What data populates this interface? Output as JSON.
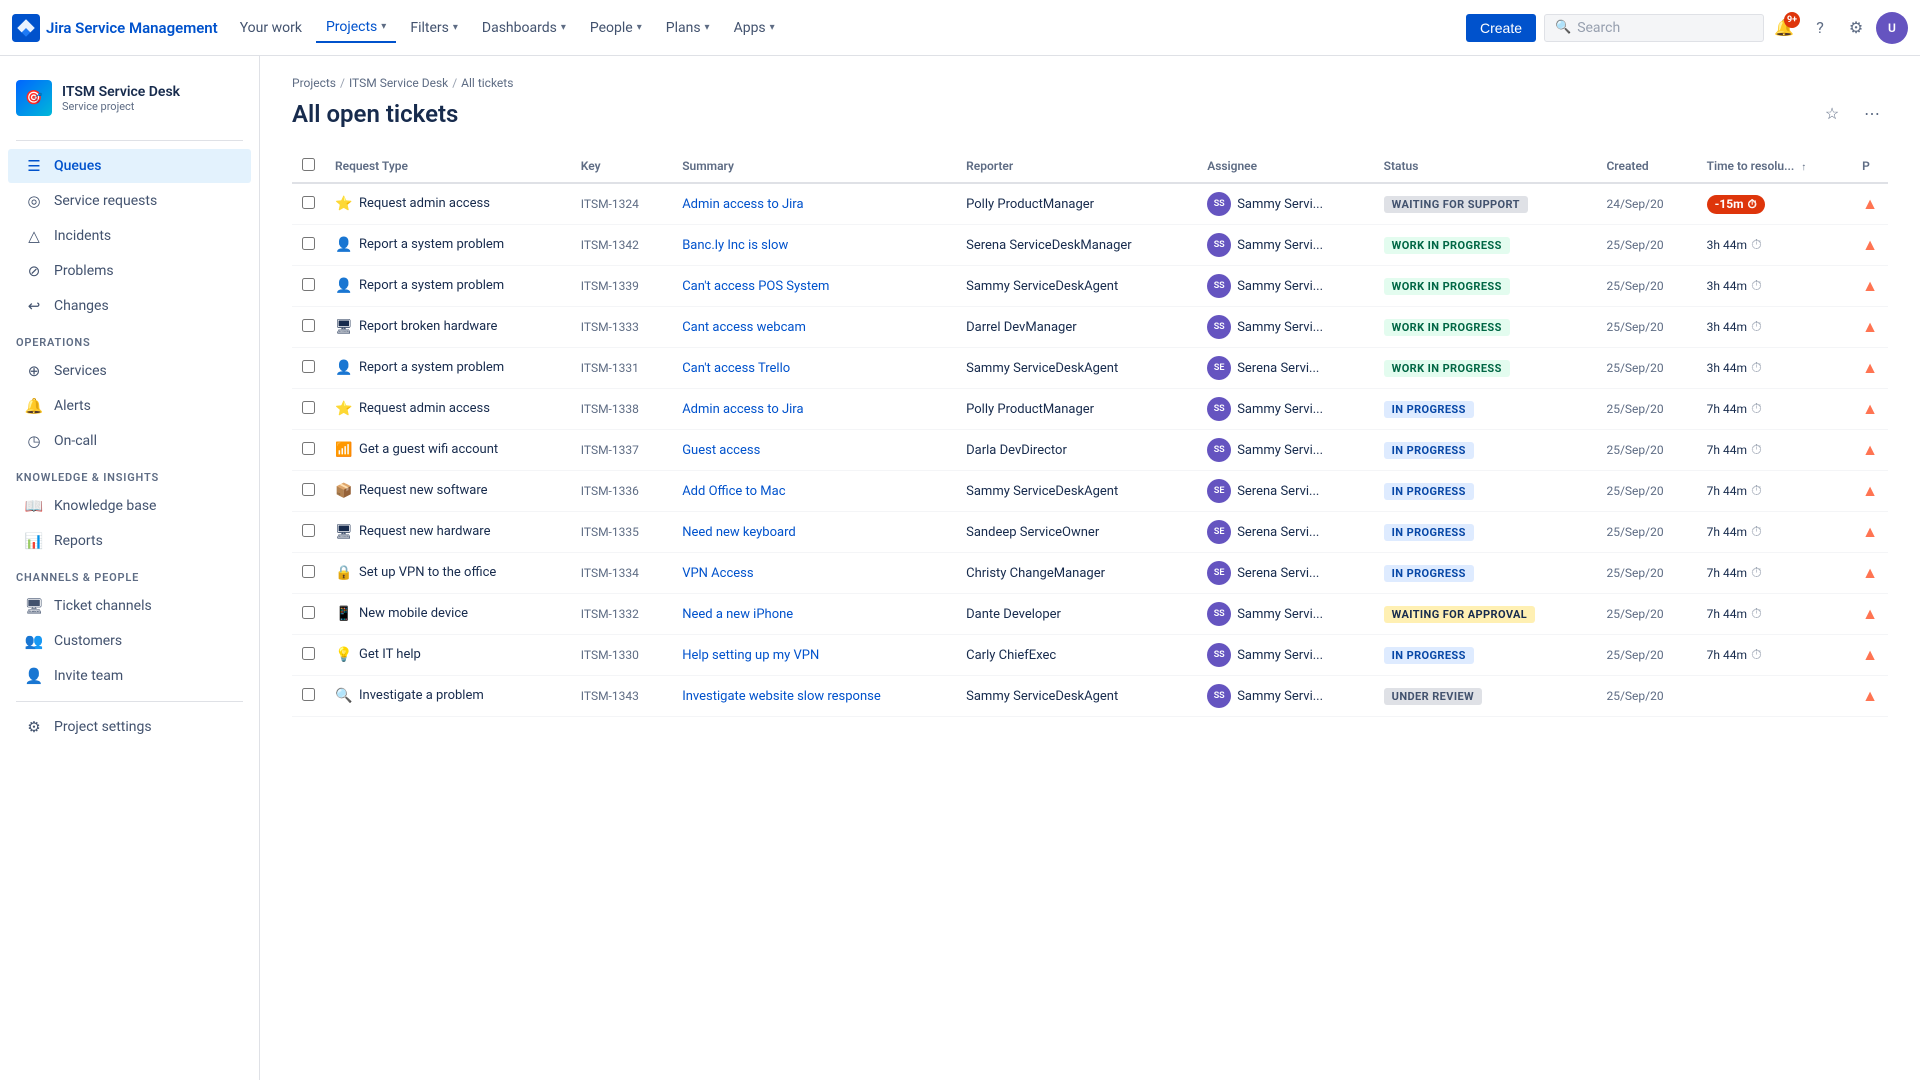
{
  "app": {
    "name": "Jira Service Management",
    "logo_text": "Jira Service Management"
  },
  "topnav": {
    "items": [
      {
        "id": "your-work",
        "label": "Your work",
        "active": false,
        "has_chevron": false
      },
      {
        "id": "projects",
        "label": "Projects",
        "active": true,
        "has_chevron": true
      },
      {
        "id": "filters",
        "label": "Filters",
        "active": false,
        "has_chevron": true
      },
      {
        "id": "dashboards",
        "label": "Dashboards",
        "active": false,
        "has_chevron": true
      },
      {
        "id": "people",
        "label": "People",
        "active": false,
        "has_chevron": true
      },
      {
        "id": "plans",
        "label": "Plans",
        "active": false,
        "has_chevron": true
      },
      {
        "id": "apps",
        "label": "Apps",
        "active": false,
        "has_chevron": true
      }
    ],
    "create_label": "Create",
    "search_placeholder": "Search",
    "notification_count": "9+",
    "avatar_initials": "U"
  },
  "sidebar": {
    "project_name": "ITSM Service Desk",
    "project_type": "Service project",
    "nav_items": [
      {
        "id": "queues",
        "label": "Queues",
        "icon": "☰",
        "active": true
      },
      {
        "id": "service-requests",
        "label": "Service requests",
        "icon": "◎",
        "active": false
      },
      {
        "id": "incidents",
        "label": "Incidents",
        "icon": "△",
        "active": false
      },
      {
        "id": "problems",
        "label": "Problems",
        "icon": "⊘",
        "active": false
      },
      {
        "id": "changes",
        "label": "Changes",
        "icon": "↩",
        "active": false
      }
    ],
    "operations_label": "OPERATIONS",
    "operations_items": [
      {
        "id": "services",
        "label": "Services",
        "icon": "⊕"
      },
      {
        "id": "alerts",
        "label": "Alerts",
        "icon": "🔔"
      },
      {
        "id": "on-call",
        "label": "On-call",
        "icon": "◷"
      }
    ],
    "knowledge_label": "KNOWLEDGE & INSIGHTS",
    "knowledge_items": [
      {
        "id": "knowledge-base",
        "label": "Knowledge base",
        "icon": "📖"
      },
      {
        "id": "reports",
        "label": "Reports",
        "icon": "📊"
      }
    ],
    "channels_label": "CHANNELS & PEOPLE",
    "channels_items": [
      {
        "id": "ticket-channels",
        "label": "Ticket channels",
        "icon": "🖥"
      },
      {
        "id": "customers",
        "label": "Customers",
        "icon": "👥"
      },
      {
        "id": "invite-team",
        "label": "Invite team",
        "icon": "👤"
      }
    ],
    "settings_label": "Project settings",
    "settings_icon": "⚙"
  },
  "breadcrumb": [
    {
      "label": "Projects",
      "href": "#"
    },
    {
      "label": "ITSM Service Desk",
      "href": "#"
    },
    {
      "label": "All tickets",
      "href": "#"
    }
  ],
  "page_title": "All open tickets",
  "table": {
    "columns": [
      {
        "id": "checkbox",
        "label": "",
        "type": "checkbox"
      },
      {
        "id": "request-type",
        "label": "Request Type"
      },
      {
        "id": "key",
        "label": "Key"
      },
      {
        "id": "summary",
        "label": "Summary"
      },
      {
        "id": "reporter",
        "label": "Reporter"
      },
      {
        "id": "assignee",
        "label": "Assignee"
      },
      {
        "id": "status",
        "label": "Status"
      },
      {
        "id": "created",
        "label": "Created"
      },
      {
        "id": "time-to-resolution",
        "label": "Time to resolu...",
        "sortable": true,
        "sort_icon": "↑"
      },
      {
        "id": "priority",
        "label": "P"
      }
    ],
    "rows": [
      {
        "checkbox": false,
        "request_type_icon": "⭐",
        "request_type": "Request admin access",
        "key": "ITSM-1324",
        "summary": "Admin access to Jira",
        "reporter": "Polly ProductManager",
        "assignee_initials": "SS",
        "assignee_name": "Sammy Servi...",
        "status": "WAITING FOR SUPPORT",
        "status_class": "status-waiting",
        "created": "24/Sep/20",
        "time": "-15m",
        "time_type": "overdue",
        "priority_icon": "▲",
        "priority_class": "priority-high"
      },
      {
        "checkbox": false,
        "request_type_icon": "👤",
        "request_type": "Report a system problem",
        "key": "ITSM-1342",
        "summary": "Banc.ly Inc is slow",
        "reporter": "Serena ServiceDeskManager",
        "assignee_initials": "SS",
        "assignee_name": "Sammy Servi...",
        "status": "WORK IN PROGRESS",
        "status_class": "status-work-in-progress",
        "created": "25/Sep/20",
        "time": "3h 44m",
        "time_type": "normal",
        "priority_icon": "▲",
        "priority_class": "priority-high"
      },
      {
        "checkbox": false,
        "request_type_icon": "👤",
        "request_type": "Report a system problem",
        "key": "ITSM-1339",
        "summary": "Can't access POS System",
        "reporter": "Sammy ServiceDeskAgent",
        "assignee_initials": "SS",
        "assignee_name": "Sammy Servi...",
        "status": "WORK IN PROGRESS",
        "status_class": "status-work-in-progress",
        "created": "25/Sep/20",
        "time": "3h 44m",
        "time_type": "normal",
        "priority_icon": "▲",
        "priority_class": "priority-high"
      },
      {
        "checkbox": false,
        "request_type_icon": "🖥",
        "request_type": "Report broken hardware",
        "key": "ITSM-1333",
        "summary": "Cant access webcam",
        "reporter": "Darrel DevManager",
        "assignee_initials": "SS",
        "assignee_name": "Sammy Servi...",
        "status": "WORK IN PROGRESS",
        "status_class": "status-work-in-progress",
        "created": "25/Sep/20",
        "time": "3h 44m",
        "time_type": "normal",
        "priority_icon": "▲",
        "priority_class": "priority-high"
      },
      {
        "checkbox": false,
        "request_type_icon": "👤",
        "request_type": "Report a system problem",
        "key": "ITSM-1331",
        "summary": "Can't access Trello",
        "reporter": "Sammy ServiceDeskAgent",
        "assignee_initials": "SE",
        "assignee_name": "Serena Servi...",
        "status": "WORK IN PROGRESS",
        "status_class": "status-work-in-progress",
        "created": "25/Sep/20",
        "time": "3h 44m",
        "time_type": "normal",
        "priority_icon": "▲",
        "priority_class": "priority-high"
      },
      {
        "checkbox": false,
        "request_type_icon": "⭐",
        "request_type": "Request admin access",
        "key": "ITSM-1338",
        "summary": "Admin access to Jira",
        "reporter": "Polly ProductManager",
        "assignee_initials": "SS",
        "assignee_name": "Sammy Servi...",
        "status": "IN PROGRESS",
        "status_class": "status-in-progress",
        "created": "25/Sep/20",
        "time": "7h 44m",
        "time_type": "normal",
        "priority_icon": "▲",
        "priority_class": "priority-high"
      },
      {
        "checkbox": false,
        "request_type_icon": "📶",
        "request_type": "Get a guest wifi account",
        "key": "ITSM-1337",
        "summary": "Guest access",
        "reporter": "Darla DevDirector",
        "assignee_initials": "SS",
        "assignee_name": "Sammy Servi...",
        "status": "IN PROGRESS",
        "status_class": "status-in-progress",
        "created": "25/Sep/20",
        "time": "7h 44m",
        "time_type": "normal",
        "priority_icon": "▲",
        "priority_class": "priority-high"
      },
      {
        "checkbox": false,
        "request_type_icon": "📦",
        "request_type": "Request new software",
        "key": "ITSM-1336",
        "summary": "Add Office to Mac",
        "reporter": "Sammy ServiceDeskAgent",
        "assignee_initials": "SE",
        "assignee_name": "Serena Servi...",
        "status": "IN PROGRESS",
        "status_class": "status-in-progress",
        "created": "25/Sep/20",
        "time": "7h 44m",
        "time_type": "normal",
        "priority_icon": "▲",
        "priority_class": "priority-high"
      },
      {
        "checkbox": false,
        "request_type_icon": "🖥",
        "request_type": "Request new hardware",
        "key": "ITSM-1335",
        "summary": "Need new keyboard",
        "reporter": "Sandeep ServiceOwner",
        "assignee_initials": "SE",
        "assignee_name": "Serena Servi...",
        "status": "IN PROGRESS",
        "status_class": "status-in-progress",
        "created": "25/Sep/20",
        "time": "7h 44m",
        "time_type": "normal",
        "priority_icon": "▲",
        "priority_class": "priority-high"
      },
      {
        "checkbox": false,
        "request_type_icon": "🔒",
        "request_type": "Set up VPN to the office",
        "key": "ITSM-1334",
        "summary": "VPN Access",
        "reporter": "Christy ChangeManager",
        "assignee_initials": "SE",
        "assignee_name": "Serena Servi...",
        "status": "IN PROGRESS",
        "status_class": "status-in-progress",
        "created": "25/Sep/20",
        "time": "7h 44m",
        "time_type": "normal",
        "priority_icon": "▲",
        "priority_class": "priority-high"
      },
      {
        "checkbox": false,
        "request_type_icon": "📱",
        "request_type": "New mobile device",
        "key": "ITSM-1332",
        "summary": "Need a new iPhone",
        "reporter": "Dante Developer",
        "assignee_initials": "SS",
        "assignee_name": "Sammy Servi...",
        "status": "WAITING FOR APPROVAL",
        "status_class": "status-waiting-approval",
        "created": "25/Sep/20",
        "time": "7h 44m",
        "time_type": "normal",
        "priority_icon": "▲",
        "priority_class": "priority-high"
      },
      {
        "checkbox": false,
        "request_type_icon": "💡",
        "request_type": "Get IT help",
        "key": "ITSM-1330",
        "summary": "Help setting up my VPN",
        "reporter": "Carly ChiefExec",
        "assignee_initials": "SS",
        "assignee_name": "Sammy Servi...",
        "status": "IN PROGRESS",
        "status_class": "status-in-progress",
        "created": "25/Sep/20",
        "time": "7h 44m",
        "time_type": "normal",
        "priority_icon": "▲",
        "priority_class": "priority-high"
      },
      {
        "checkbox": false,
        "request_type_icon": "🔍",
        "request_type": "Investigate a problem",
        "key": "ITSM-1343",
        "summary": "Investigate website slow response",
        "reporter": "Sammy ServiceDeskAgent",
        "assignee_initials": "SS",
        "assignee_name": "Sammy Servi...",
        "status": "UNDER REVIEW",
        "status_class": "status-under-review",
        "created": "25/Sep/20",
        "time": "",
        "time_type": "none",
        "priority_icon": "▲",
        "priority_class": "priority-high"
      }
    ]
  }
}
